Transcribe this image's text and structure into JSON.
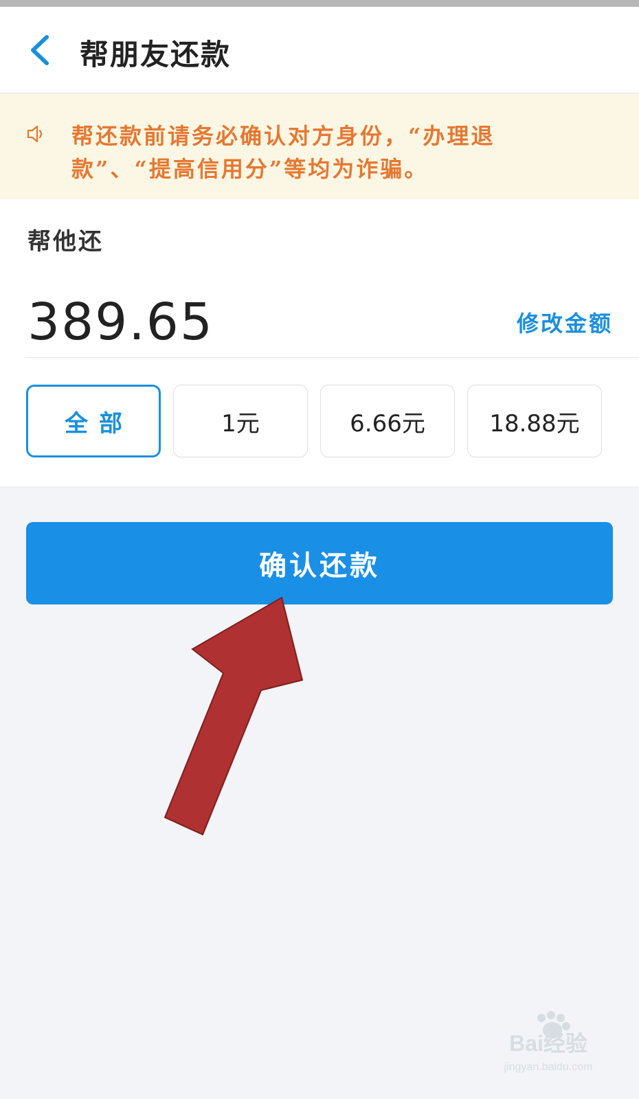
{
  "header": {
    "title": "帮朋友还款"
  },
  "notice": {
    "text": "帮还款前请务必确认对方身份，“办理退款”、“提高信用分”等均为诈骗。"
  },
  "repay": {
    "label": "帮他还",
    "amount": "389.65",
    "modify_label": "修改金额"
  },
  "amount_options": [
    {
      "label": "全部",
      "selected": true
    },
    {
      "label": "1元",
      "selected": false
    },
    {
      "label": "6.66元",
      "selected": false
    },
    {
      "label": "18.88元",
      "selected": false
    }
  ],
  "confirm_button": {
    "label": "确认还款"
  },
  "colors": {
    "accent": "#1a8fe6",
    "notice_text": "#e57832",
    "notice_bg": "#fcf7e4",
    "page_bg": "#f2f4f7",
    "arrow": "#b03131"
  },
  "icons": {
    "back": "chevron-left-icon",
    "notice": "speaker-icon"
  },
  "watermark": {
    "text": "Bai经验",
    "url_text": "jingyan.baidu.com"
  }
}
